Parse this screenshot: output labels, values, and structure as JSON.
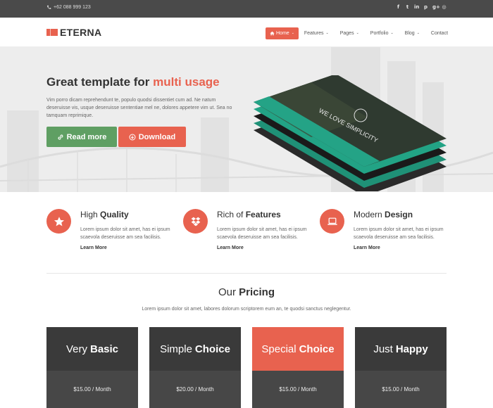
{
  "topbar": {
    "phone": "+62 088 999 123",
    "socials": [
      "facebook-icon",
      "twitter-icon",
      "linkedin-icon",
      "pinterest-icon",
      "google-plus-icon",
      "dribbble-icon"
    ]
  },
  "header": {
    "logo": "ETERNA",
    "nav": [
      {
        "label": "Home",
        "active": true,
        "has_dropdown": true
      },
      {
        "label": "Features",
        "has_dropdown": true
      },
      {
        "label": "Pages",
        "has_dropdown": true
      },
      {
        "label": "Portfolio",
        "has_dropdown": true
      },
      {
        "label": "Blog",
        "has_dropdown": true
      },
      {
        "label": "Contact",
        "has_dropdown": false
      }
    ]
  },
  "hero": {
    "title_plain": "Great template for ",
    "title_accent": "multi usage",
    "text": "Vim porro dicam reprehendunt te, populo quodsi dissentiet cum ad. Ne natum deseruisse vis, usque deseruisse sententiae mel ne, dolores appetere vim ut. Sea no tamquam reprimique.",
    "read_more": "Read more",
    "download": "Download",
    "mockup_text": "WE LOVE SIMPLICITY"
  },
  "features": [
    {
      "title_plain": "High ",
      "title_bold": "Quality",
      "icon": "star-icon",
      "text": "Lorem ipsum dolor sit amet, has ei ipsum scaevola deseruisse am sea facilisis.",
      "link": "Learn More"
    },
    {
      "title_plain": "Rich of ",
      "title_bold": "Features",
      "icon": "dropbox-icon",
      "text": "Lorem ipsum dolor sit amet, has ei ipsum scaevola deseruisse am sea facilisis.",
      "link": "Learn More"
    },
    {
      "title_plain": "Modern ",
      "title_bold": "Design",
      "icon": "laptop-icon",
      "text": "Lorem ipsum dolor sit amet, has ei ipsum scaevola deseruisse am sea facilisis.",
      "link": "Learn More"
    }
  ],
  "pricing": {
    "title_plain": "Our ",
    "title_bold": "Pricing",
    "subtitle": "Lorem ipsum dolor sit amet, labores dolorum scriptorem eum an, te quodsi sanctus neglegentur.",
    "plans": [
      {
        "name_plain": "Very",
        "name_bold": "Basic",
        "price": "$15.00 / Month",
        "highlight": false
      },
      {
        "name_plain": "Simple",
        "name_bold": "Choice",
        "price": "$20.00 / Month",
        "highlight": false
      },
      {
        "name_plain": "Special",
        "name_bold": "Choice",
        "price": "$15.00 / Month",
        "highlight": true
      },
      {
        "name_plain": "Just",
        "name_bold": "Happy",
        "price": "$15.00 / Month",
        "highlight": false
      }
    ]
  },
  "colors": {
    "accent": "#e8624f",
    "green": "#5f9f63",
    "dark": "#3a3a3a",
    "topbar": "#4a4a4a",
    "teal": "#2aa88a"
  }
}
